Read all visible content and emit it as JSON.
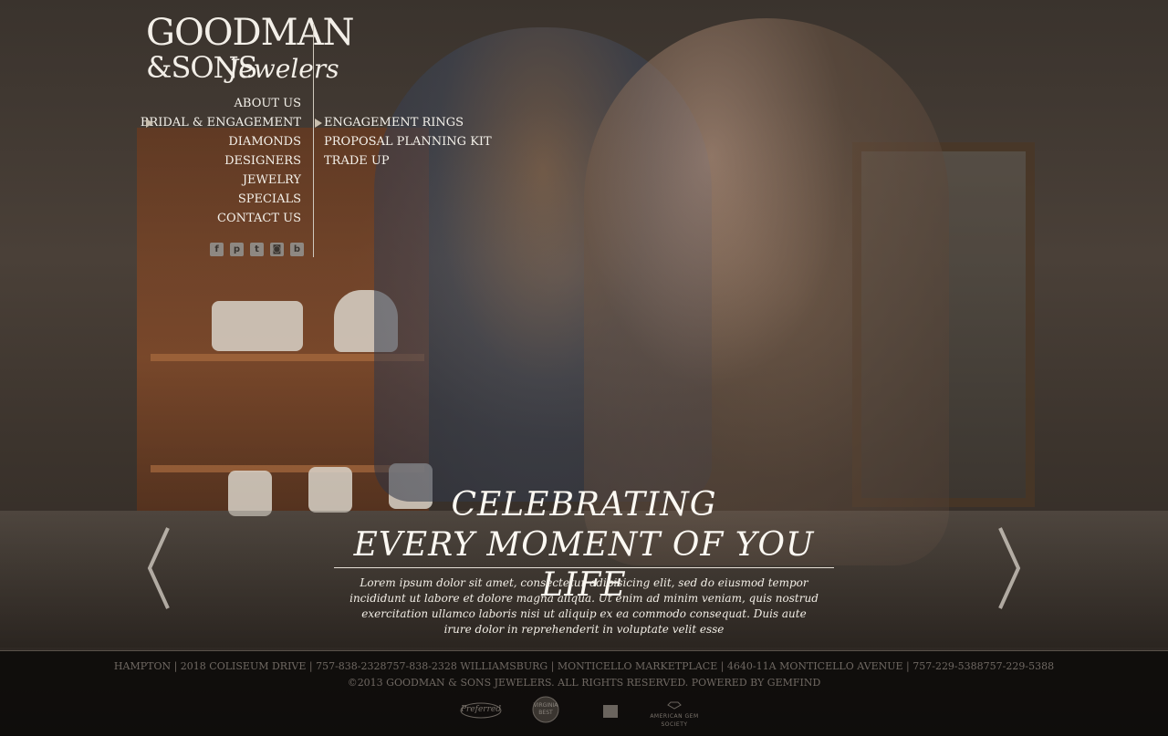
{
  "brand": {
    "line1": "GOODMAN",
    "line2": "&SONS",
    "line3": "Jewelers"
  },
  "nav": {
    "items": [
      {
        "label": "ABOUT US"
      },
      {
        "label": "BRIDAL & ENGAGEMENT",
        "active": true
      },
      {
        "label": "DIAMONDS"
      },
      {
        "label": "DESIGNERS"
      },
      {
        "label": "JEWELRY"
      },
      {
        "label": "SPECIALS"
      },
      {
        "label": "CONTACT US"
      }
    ],
    "submenu": [
      {
        "label": "ENGAGEMENT RINGS",
        "active": true
      },
      {
        "label": "PROPOSAL PLANNING KIT"
      },
      {
        "label": "TRADE UP"
      }
    ]
  },
  "social": [
    {
      "icon": "facebook-icon",
      "glyph": "f"
    },
    {
      "icon": "pinterest-icon",
      "glyph": "p"
    },
    {
      "icon": "twitter-icon",
      "glyph": "t"
    },
    {
      "icon": "instagram-icon",
      "glyph": "◙"
    },
    {
      "icon": "blogger-icon",
      "glyph": "b"
    }
  ],
  "hero": {
    "title_line1": "CELEBRATING",
    "title_line2": "EVERY MOMENT OF YOU LIFE",
    "body": "Lorem ipsum dolor sit amet, consectetur adipisicing elit, sed do eiusmod tempor incididunt ut labore et dolore magna aliqua. Ut enim ad minim veniam, quis nostrud exercitation ullamco laboris nisi ut aliquip ex ea commodo consequat. Duis aute irure dolor in reprehenderit in voluptate velit esse"
  },
  "footer": {
    "address": "HAMPTON | 2018 COLISEUM DRIVE | 757-838-2328757-838-2328 WILLIAMSBURG | MONTICELLO MARKETPLACE | 4640-11A MONTICELLO AVENUE | 757-229-5388757-229-5388",
    "copyright": "©2013 GOODMAN & SONS JEWELERS. ALL RIGHTS RESERVED. POWERED BY GEMFIND",
    "badges": [
      {
        "icon": "preferred-badge-icon",
        "text": "Preferred"
      },
      {
        "icon": "virginia-best-badge-icon",
        "text": "VIRGINIA BEST"
      },
      {
        "icon": "bbb-badge-icon",
        "text": ""
      },
      {
        "icon": "american-gem-society-icon",
        "text": "AMERICAN GEM SOCIETY"
      }
    ]
  },
  "colors": {
    "text": "#f4f1ea",
    "arrow": "#c9bfae",
    "footer_text": "#6f6862"
  }
}
